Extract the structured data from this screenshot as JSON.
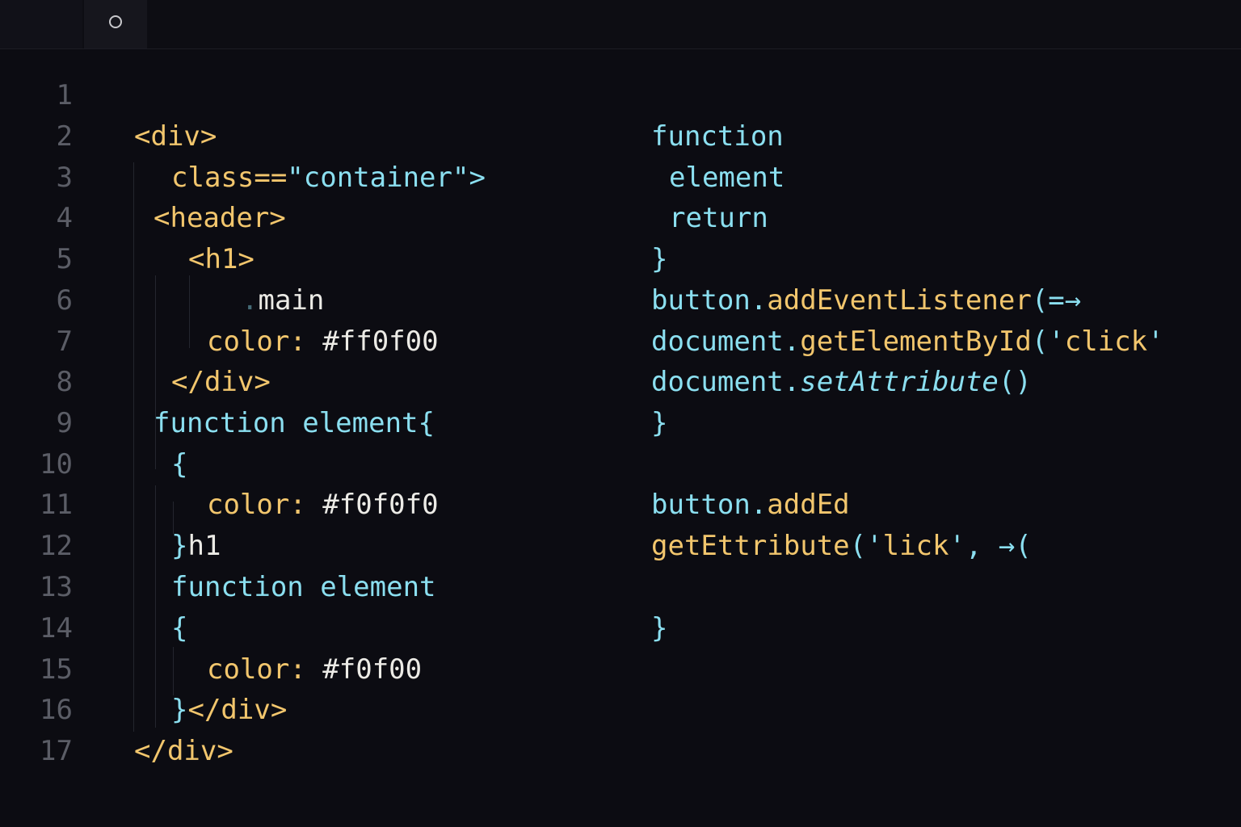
{
  "tabs": [
    {
      "label": "",
      "icon": "circle-icon"
    }
  ],
  "line_numbers": [
    "1",
    "2",
    "3",
    "4",
    "5",
    "6",
    "7",
    "8",
    "9",
    "10",
    "11",
    "12",
    "13",
    "14",
    "15",
    "16",
    "17"
  ],
  "left_pane": {
    "line2": [
      {
        "t": "<div>"
      }
    ],
    "line3": [
      {
        "t": "class=="
      },
      {
        "t": "\"container\">"
      }
    ],
    "line4": [
      {
        "t": "<header>"
      }
    ],
    "line5": [
      {
        "t": "<h1>"
      }
    ],
    "line6": [
      {
        "t": "."
      },
      {
        "t": "main"
      }
    ],
    "line7": [
      {
        "t": "color: "
      },
      {
        "t": "#ff0f00"
      }
    ],
    "line8": [
      {
        "t": "</div>"
      }
    ],
    "line9": [
      {
        "t": "function element{"
      }
    ],
    "line10": [
      {
        "t": "{"
      }
    ],
    "line11": [
      {
        "t": "color: "
      },
      {
        "t": "#f0f0f0"
      }
    ],
    "line12": [
      {
        "t": "}"
      },
      {
        "t": "h1"
      }
    ],
    "line13": [
      {
        "t": "function element"
      }
    ],
    "line14": [
      {
        "t": "{"
      }
    ],
    "line15": [
      {
        "t": "color: "
      },
      {
        "t": "#f0f00"
      }
    ],
    "line16": [
      {
        "t": "}"
      },
      {
        "t": "</div>"
      }
    ],
    "line17": [
      {
        "t": "</div>"
      }
    ]
  },
  "right_pane": {
    "line2": [
      {
        "t": "function"
      }
    ],
    "line3": [
      {
        "t": "element"
      }
    ],
    "line4": [
      {
        "t": "return"
      }
    ],
    "line5": [
      {
        "t": "}"
      }
    ],
    "line6": [
      {
        "t": "button."
      },
      {
        "t": "addEventListener"
      },
      {
        "t": "(=→"
      }
    ],
    "line7": [
      {
        "t": "document."
      },
      {
        "t": "getElementById"
      },
      {
        "t": "('"
      },
      {
        "t": "click"
      },
      {
        "t": "'"
      }
    ],
    "line8": [
      {
        "t": "document."
      },
      {
        "t": "setAttribute"
      },
      {
        "t": "()"
      }
    ],
    "line9": [
      {
        "t": "}"
      }
    ],
    "line11": [
      {
        "t": "button."
      },
      {
        "t": "addEd"
      }
    ],
    "line12": [
      {
        "t": "getEttribute"
      },
      {
        "t": "('"
      },
      {
        "t": "lick"
      },
      {
        "t": "', →("
      }
    ],
    "line14": [
      {
        "t": "}"
      }
    ]
  },
  "colors": {
    "background": "#0c0c12",
    "line_number": "#5b5d66",
    "keyword_orange": "#f2c66d",
    "keyword_cyan": "#8bdff0",
    "text_white": "#ecebe6"
  }
}
